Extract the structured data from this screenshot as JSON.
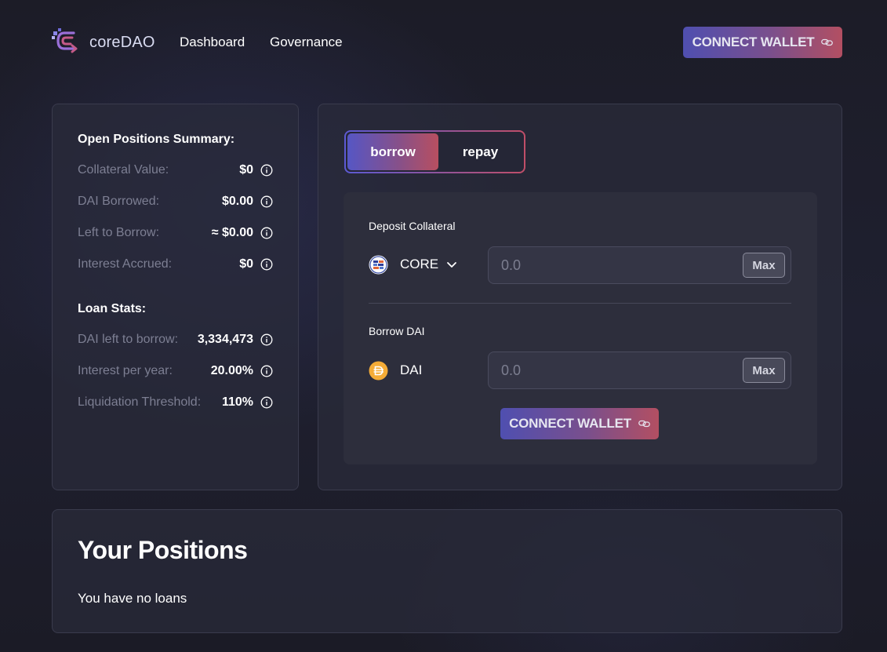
{
  "brand": {
    "name": "coreDAO"
  },
  "nav": {
    "dashboard": "Dashboard",
    "governance": "Governance"
  },
  "header": {
    "connect_label": "CONNECT WALLET"
  },
  "summary": {
    "open_heading": "Open Positions Summary:",
    "open_rows": [
      {
        "label": "Collateral Value:",
        "value": "$0"
      },
      {
        "label": "DAI Borrowed:",
        "value": "$0.00"
      },
      {
        "label": "Left to Borrow:",
        "value": "≈ $0.00"
      },
      {
        "label": "Interest Accrued:",
        "value": "$0"
      }
    ],
    "loan_heading": "Loan Stats:",
    "loan_rows": [
      {
        "label": "DAI left to borrow:",
        "value": "3,334,473"
      },
      {
        "label": "Interest per year:",
        "value": "20.00%"
      },
      {
        "label": "Liquidation Threshold:",
        "value": "110%"
      }
    ]
  },
  "tabs": {
    "borrow": "borrow",
    "repay": "repay",
    "active": "borrow"
  },
  "form": {
    "deposit_label": "Deposit Collateral",
    "deposit_token": "CORE",
    "deposit_placeholder": "0.0",
    "borrow_label": "Borrow DAI",
    "borrow_token": "DAI",
    "borrow_placeholder": "0.0",
    "max_label": "Max",
    "connect_label": "CONNECT WALLET"
  },
  "positions": {
    "title": "Your Positions",
    "empty_text": "You have no loans"
  },
  "colors": {
    "accent_start": "#4f4fb0",
    "accent_end": "#b34f62",
    "background": "#1b1b26",
    "panel": "#2a2b3a",
    "muted_text": "#7d7f93",
    "dai_yellow": "#f5ac37"
  },
  "icons": {
    "logo": "coredao-logo-icon",
    "link": "link-chain-icon",
    "info": "info-circle-icon",
    "core_token": "core-token-icon",
    "dai_token": "dai-token-icon",
    "chevron": "chevron-down-icon"
  }
}
